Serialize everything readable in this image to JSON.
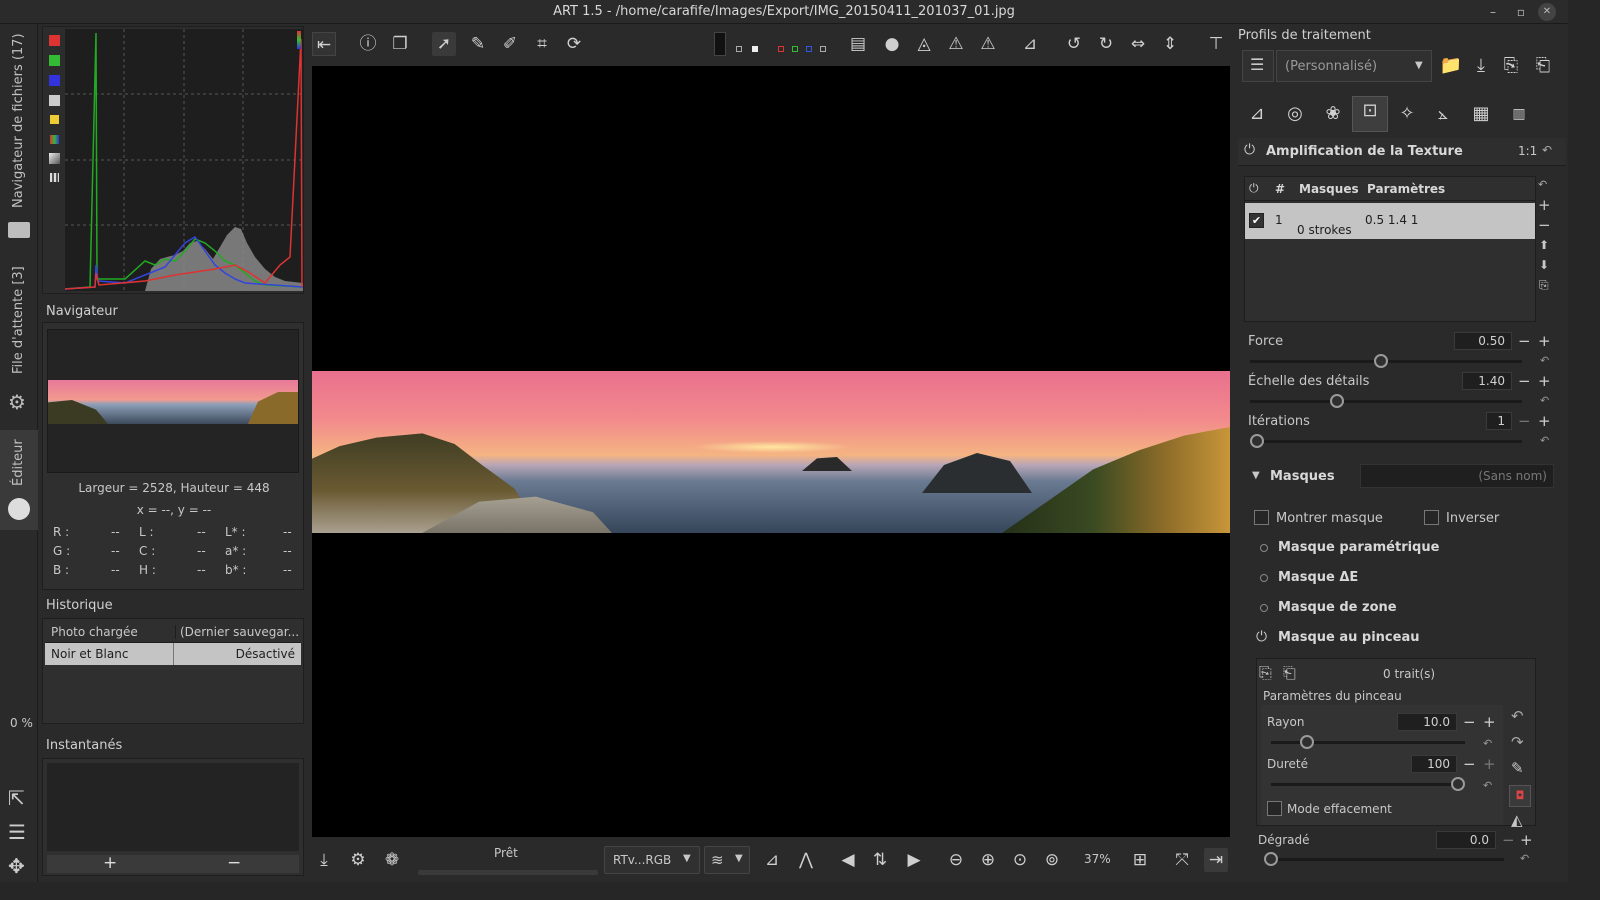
{
  "window": {
    "title": "ART 1.5 - /home/carafife/Images/Export/IMG_20150411_201037_01.jpg",
    "min": "–",
    "max": "▫",
    "close": "✕"
  },
  "left_rail": {
    "tab_files": "Navigateur de fichiers (17)",
    "tab_queue": "File d'attente [3]",
    "tab_editor": "Éditeur",
    "progress": "0 %"
  },
  "navigator": {
    "title": "Navigateur",
    "dims": "Largeur = 2528, Hauteur = 448",
    "xy": "x = --, y = --",
    "readout": [
      {
        "k": "R :",
        "v": "--"
      },
      {
        "k": "L :",
        "v": "--"
      },
      {
        "k": "L* :",
        "v": "--"
      },
      {
        "k": "G :",
        "v": "--"
      },
      {
        "k": "C :",
        "v": "--"
      },
      {
        "k": "a* :",
        "v": "--"
      },
      {
        "k": "B :",
        "v": "--"
      },
      {
        "k": "H :",
        "v": "--"
      },
      {
        "k": "b* :",
        "v": "--"
      }
    ]
  },
  "history": {
    "title": "Historique",
    "rows": [
      {
        "name": "Photo chargée",
        "value": "(Dernier sauvegar..."
      },
      {
        "name": "Noir et Blanc",
        "value": "Désactivé"
      }
    ]
  },
  "snapshots": {
    "title": "Instantanés",
    "add": "+",
    "remove": "−"
  },
  "bottom_bar": {
    "status": "Prêt",
    "profile": "RTv...RGB",
    "zoom": "37%"
  },
  "right": {
    "profiles_title": "Profils de traitement",
    "profile_value": "(Personnalisé)",
    "module_title": "Amplification de la Texture",
    "module_ratio": "1:1",
    "mask_table": {
      "col_hash": "#",
      "col_masks": "Masques",
      "col_params": "Paramètres",
      "rows": [
        {
          "num": "1",
          "masks": "0 strokes",
          "params": "0.5 1.4 1"
        }
      ]
    },
    "force": {
      "label": "Force",
      "value": "0.50",
      "pos": 0.48
    },
    "scale": {
      "label": "Échelle des détails",
      "value": "1.40",
      "pos": 0.31
    },
    "iter": {
      "label": "Itérations",
      "value": "1",
      "pos": 0.0
    },
    "masks_title": "Masques",
    "masks_name": "(Sans nom)",
    "show_mask": "Montrer masque",
    "invert": "Inverser",
    "parametric": "Masque paramétrique",
    "delta_e": "Masque ΔE",
    "zone": "Masque de zone",
    "brush": "Masque au pinceau",
    "strokes": "0 trait(s)",
    "brush_params": "Paramètres du pinceau",
    "radius": {
      "label": "Rayon",
      "value": "10.0",
      "pos": 0.16
    },
    "hardness": {
      "label": "Dureté",
      "value": "100",
      "pos": 1.0
    },
    "erase": "Mode effacement",
    "gradient": {
      "label": "Dégradé",
      "value": "0.0",
      "pos": 0.0
    }
  }
}
